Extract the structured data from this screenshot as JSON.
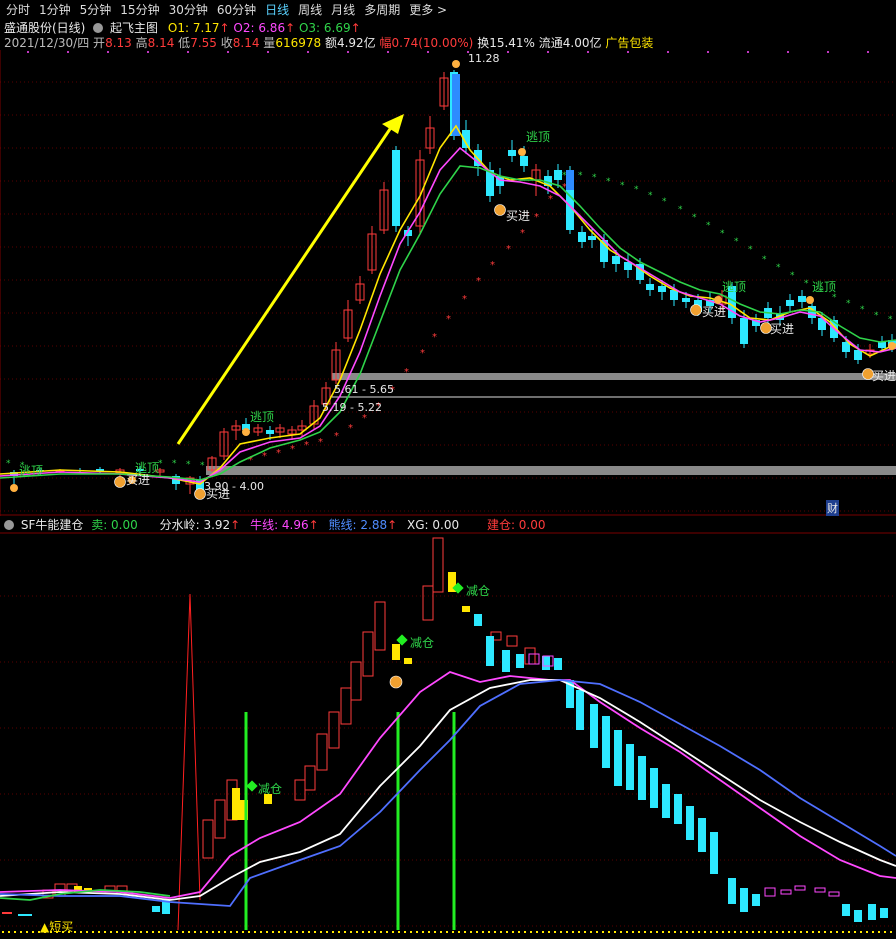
{
  "toolbar": {
    "items": [
      "分时",
      "1分钟",
      "5分钟",
      "15分钟",
      "30分钟",
      "60分钟",
      "日线",
      "周线",
      "月线",
      "多周期",
      "更多"
    ],
    "active": "日线"
  },
  "header": {
    "stock": "盛通股份(日线)",
    "indicator": "起飞主图",
    "o1": "O1: 7.17",
    "o2": "O2: 6.86",
    "o3": "O3: 6.69"
  },
  "quote": {
    "date": "2021/12/30/四",
    "open_label": "开",
    "open": "8.13",
    "high_label": "高",
    "high": "8.14",
    "low_label": "低",
    "low": "7.55",
    "close_label": "收",
    "close": "8.14",
    "vol_label": "量",
    "vol": "616978",
    "amount": "额4.92亿",
    "change": "幅0.74(10.00%)",
    "turnover": "换15.41%",
    "float": "流通4.00亿",
    "ad": "广告包装"
  },
  "main_chart": {
    "peak_label": "11.28",
    "zone_upper": "5.61 - 5.65",
    "zone_mid": "5.19 - 5.22",
    "zone_lower": "3.90 - 4.00",
    "marker_escape": "逃顶",
    "marker_buy": "买进",
    "marker_fin": "财",
    "colors": {
      "up": "#ff3b3b",
      "down": "#2de8ff",
      "ma_yellow": "#ffe600",
      "ma_magenta": "#ff49ff",
      "ma_green": "#2fd44a",
      "arrow": "#ffff00",
      "zone": "#8a8a8a"
    }
  },
  "sub_panel": {
    "title": "SF牛能建仓",
    "sell": "卖: 0.00",
    "watershed": "分水岭: 3.92",
    "bull": "牛线: 4.96",
    "bear": "熊线: 2.88",
    "xg": "XG: 0.00",
    "build": "建仓: 0.00",
    "reduce_label": "减仓",
    "short_buy": "▲短买"
  },
  "chart_data": {
    "type": "candlestick",
    "main_price_range": [
      3.9,
      11.28
    ],
    "series": [
      {
        "name": "O1",
        "last": 7.17
      },
      {
        "name": "O2",
        "last": 6.86
      },
      {
        "name": "O3",
        "last": 6.69
      }
    ],
    "sub_series": [
      {
        "name": "分水岭",
        "last": 3.92
      },
      {
        "name": "牛线",
        "last": 4.96
      },
      {
        "name": "熊线",
        "last": 2.88
      }
    ]
  }
}
